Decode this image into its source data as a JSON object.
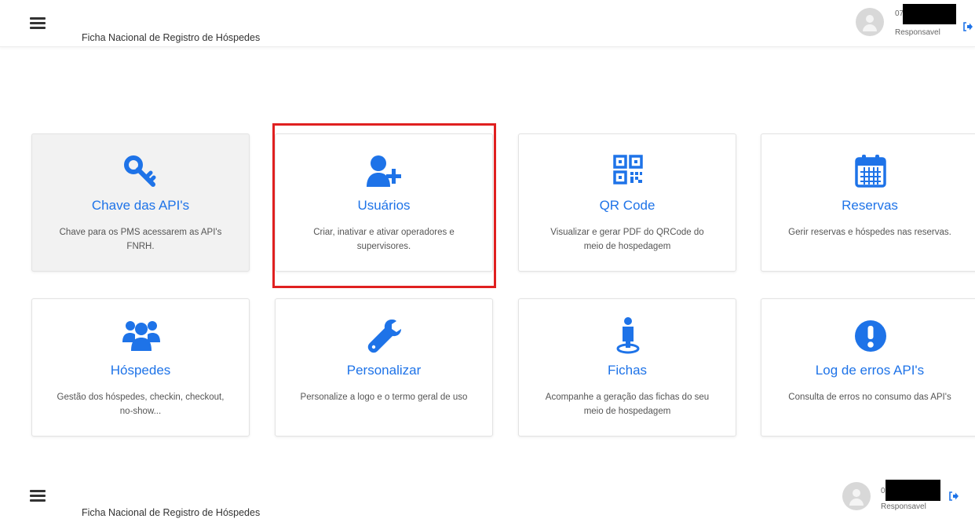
{
  "header_top": {
    "title": "Ficha Nacional de Registro de Hóspedes",
    "user_id": "07",
    "role": "Responsavel"
  },
  "header_bottom": {
    "title": "Ficha Nacional de Registro de Hóspedes",
    "user_id": "0",
    "role": "Responsavel"
  },
  "colors": {
    "accent": "#1e73e8",
    "highlight": "#e02020",
    "active_card": "#f2f2f2"
  },
  "cards": [
    {
      "icon": "key-icon",
      "title": "Chave das API's",
      "description": "Chave para os PMS acessarem as API's FNRH."
    },
    {
      "icon": "user-plus-icon",
      "title": "Usuários",
      "description": "Criar, inativar e ativar operadores e supervisores."
    },
    {
      "icon": "qr-code-icon",
      "title": "QR Code",
      "description": "Visualizar e gerar PDF do QRCode do meio de hospedagem"
    },
    {
      "icon": "calendar-icon",
      "title": "Reservas",
      "description": "Gerir reservas e hóspedes nas reservas."
    },
    {
      "icon": "users-group-icon",
      "title": "Hóspedes",
      "description": "Gestão dos hóspedes, checkin, checkout, no-show..."
    },
    {
      "icon": "wrench-icon",
      "title": "Personalizar",
      "description": "Personalize a logo e o termo geral de uso"
    },
    {
      "icon": "person-pin-icon",
      "title": "Fichas",
      "description": "Acompanhe a geração das fichas do seu meio de hospedagem"
    },
    {
      "icon": "exclamation-icon",
      "title": "Log de erros API's",
      "description": "Consulta de erros no consumo das API's"
    }
  ]
}
